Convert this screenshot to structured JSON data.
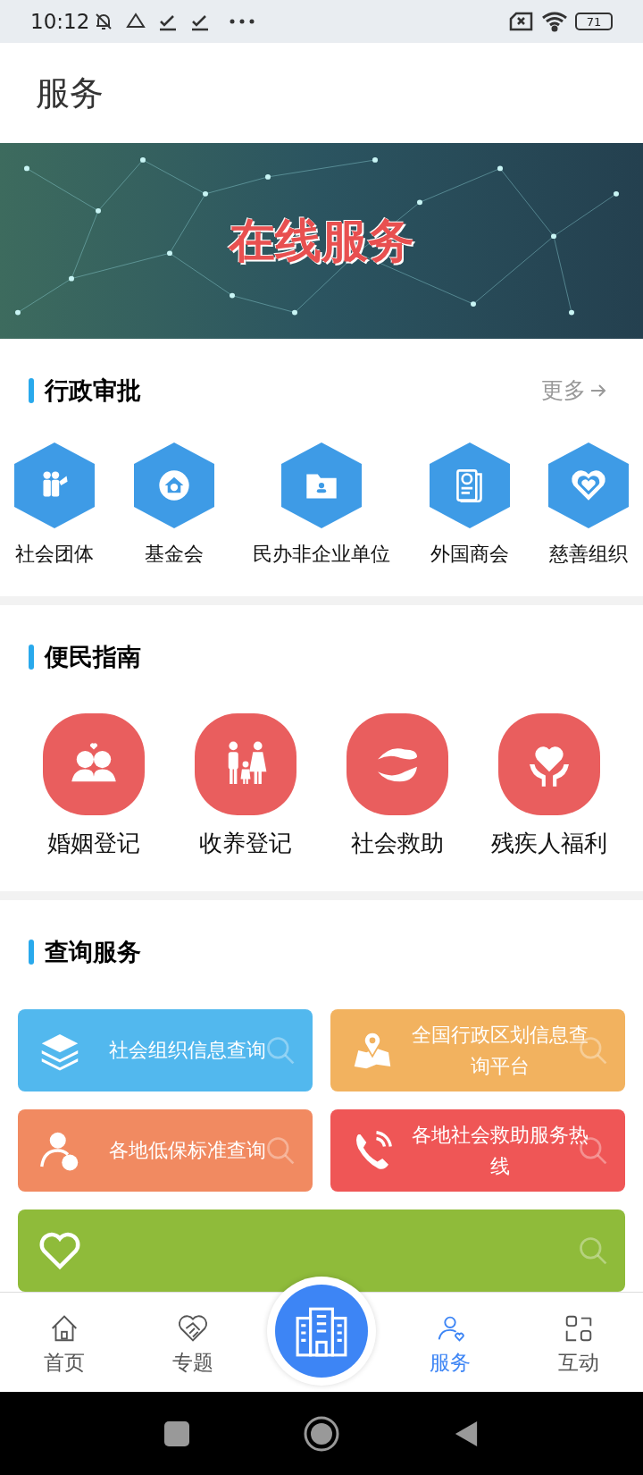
{
  "status_bar": {
    "time": "10:12",
    "battery": "71"
  },
  "header": {
    "title": "服务"
  },
  "banner": {
    "title": "在线服务"
  },
  "admin_approval": {
    "title": "行政审批",
    "more": "更多",
    "items": [
      {
        "label": "社会团体"
      },
      {
        "label": "基金会"
      },
      {
        "label": "民办非企业单位"
      },
      {
        "label": "外国商会"
      },
      {
        "label": "慈善组织"
      }
    ]
  },
  "guide": {
    "title": "便民指南",
    "items": [
      {
        "label": "婚姻登记"
      },
      {
        "label": "收养登记"
      },
      {
        "label": "社会救助"
      },
      {
        "label": "残疾人福利"
      }
    ]
  },
  "query": {
    "title": "查询服务",
    "cards": [
      {
        "label": "社会组织信息查询",
        "color": "#52b8ee"
      },
      {
        "label": "全国行政区划信息查询平台",
        "color": "#f2b25f"
      },
      {
        "label": "各地低保标准查询",
        "color": "#f18a61"
      },
      {
        "label": "各地社会救助服务热线",
        "color": "#ef5656"
      },
      {
        "color": "#8fbb3a"
      }
    ]
  },
  "nav": {
    "items": [
      {
        "label": "首页",
        "selected": false
      },
      {
        "label": "专题",
        "selected": false
      },
      {
        "label": "服务",
        "selected": true
      },
      {
        "label": "互动",
        "selected": false
      }
    ]
  }
}
